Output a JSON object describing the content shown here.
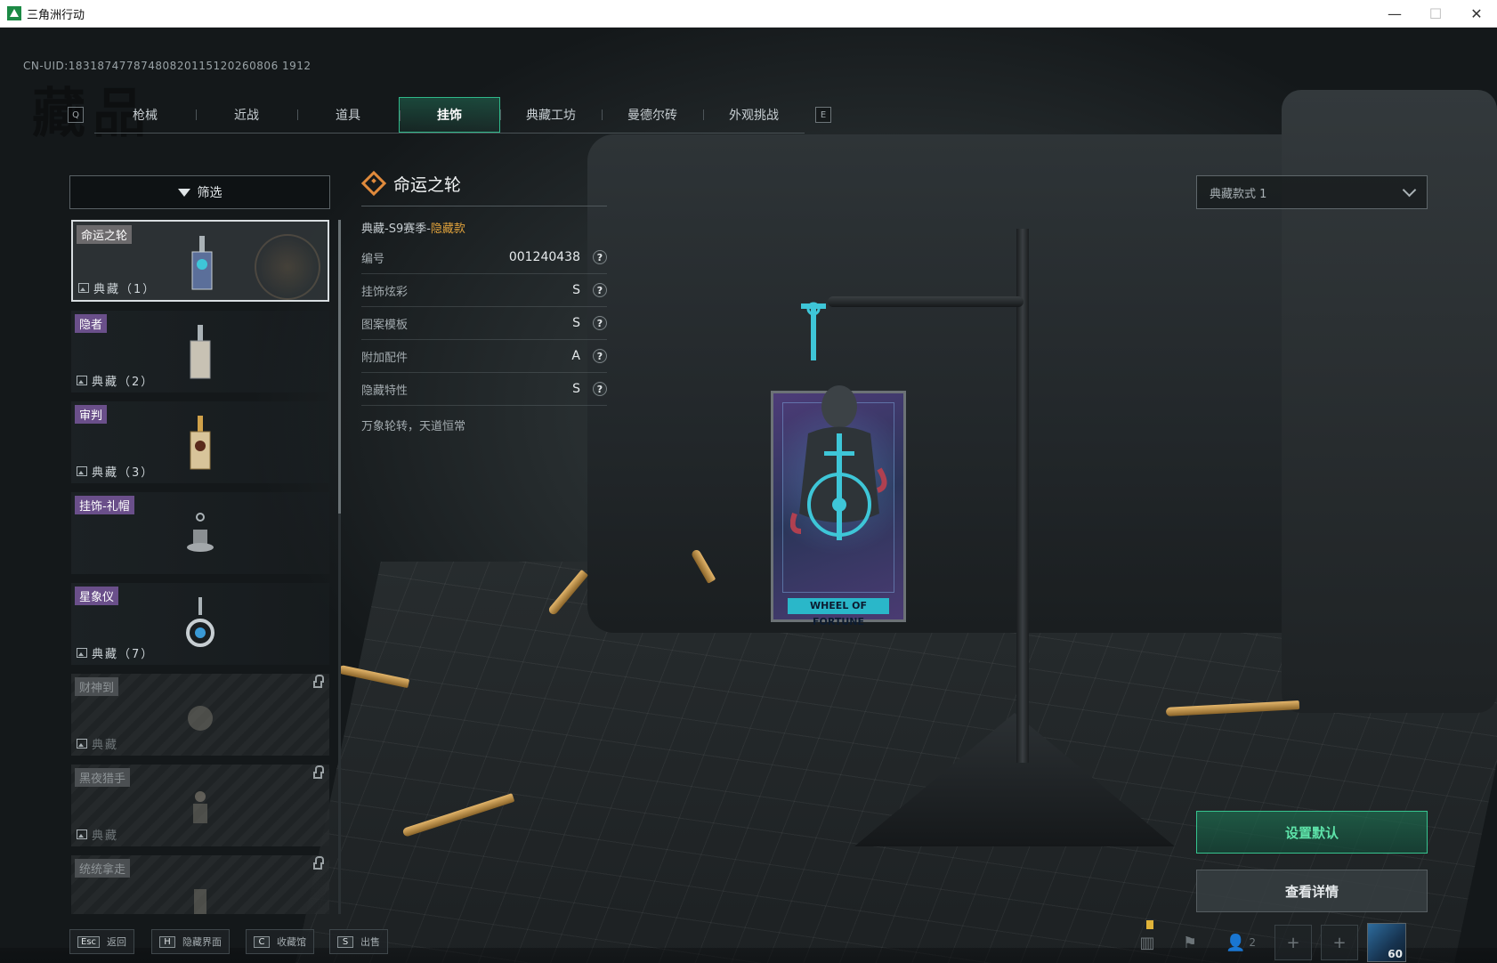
{
  "window": {
    "title": "三角洲行动",
    "minimize": "—",
    "maximize": "☐",
    "close": "✕"
  },
  "uid": "CN-UID:18318747787480820115120260806 1912",
  "page_bg_title": "藏品",
  "tabs": {
    "prev_key": "Q",
    "next_key": "E",
    "items": [
      {
        "label": "枪械"
      },
      {
        "label": "近战"
      },
      {
        "label": "道具"
      },
      {
        "label": "挂饰"
      },
      {
        "label": "典藏工坊"
      },
      {
        "label": "曼德尔砖"
      },
      {
        "label": "外观挑战"
      }
    ],
    "active_index": 3
  },
  "filter": {
    "label": "筛选"
  },
  "list": {
    "items": [
      {
        "name": "命运之轮",
        "collect": "典藏（1）",
        "selected": true,
        "locked": false
      },
      {
        "name": "隐者",
        "collect": "典藏（2）",
        "selected": false,
        "locked": false
      },
      {
        "name": "审判",
        "collect": "典藏（3）",
        "selected": false,
        "locked": false
      },
      {
        "name": "挂饰-礼帽",
        "collect": "",
        "selected": false,
        "locked": false
      },
      {
        "name": "星象仪",
        "collect": "典藏（7）",
        "selected": false,
        "locked": false
      },
      {
        "name": "财神到",
        "collect": "典藏",
        "selected": false,
        "locked": true
      },
      {
        "name": "黑夜猎手",
        "collect": "典藏",
        "selected": false,
        "locked": true
      },
      {
        "name": "统统拿走",
        "collect": "",
        "selected": false,
        "locked": true
      }
    ]
  },
  "detail": {
    "title": "命运之轮",
    "season_prefix": "典藏-S9赛季-",
    "season_hidden": "隐藏款",
    "stats": [
      {
        "label": "编号",
        "value": "001240438"
      },
      {
        "label": "挂饰炫彩",
        "value": "S"
      },
      {
        "label": "图案模板",
        "value": "S"
      },
      {
        "label": "附加配件",
        "value": "A"
      },
      {
        "label": "隐藏特性",
        "value": "S"
      }
    ],
    "help": "?",
    "motto": "万象轮转，天道恒常"
  },
  "style_select": {
    "value": "典藏款式 1"
  },
  "card_label": "WHEEL OF FORTUNE",
  "actions": {
    "set_default": "设置默认",
    "view_detail": "查看详情"
  },
  "hotkeys": [
    {
      "key": "Esc",
      "label": "返回"
    },
    {
      "key": "H",
      "label": "隐藏界面"
    },
    {
      "key": "C",
      "label": "收藏馆"
    },
    {
      "key": "S",
      "label": "出售"
    }
  ],
  "system": {
    "friend_count": "2",
    "level": "60"
  },
  "colors": {
    "accent_green": "#36c48f",
    "hidden_gold": "#e0a23c",
    "tag_purple": "#6a4f8a"
  }
}
